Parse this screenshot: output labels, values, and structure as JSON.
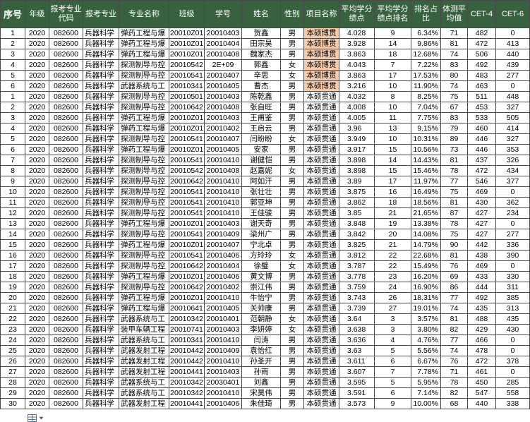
{
  "colors": {
    "header_bg": "#38613f",
    "header_text": "#ffffff",
    "highlight_fill": "#f8cbad",
    "grid_line": "#4a4a4a"
  },
  "table": {
    "headers": [
      "序号",
      "年级",
      "报考专业代码",
      "报考专业",
      "专业名称",
      "班级",
      "学号",
      "姓名",
      "性别",
      "项目名称",
      "平均学分绩点",
      "平均学分绩点排名",
      "排名占比",
      "体测平均值",
      "CET-4",
      "CET-6"
    ],
    "rows": [
      {
        "cells": [
          "1",
          "2020",
          "082600",
          "兵器科学",
          "弹药工程与爆",
          "20010Z01",
          "20010403",
          "贺鑫",
          "男",
          "本硕博贯",
          "4.028",
          "9",
          "6.34%",
          "71",
          "482",
          "0"
        ],
        "highlight": true
      },
      {
        "cells": [
          "2",
          "2020",
          "082600",
          "兵器科学",
          "弹药工程与爆",
          "20010Z01",
          "20010404",
          "田宗昊",
          "男",
          "本硕博贯",
          "3.928",
          "14",
          "9.86%",
          "81",
          "472",
          "413"
        ],
        "highlight": true
      },
      {
        "cells": [
          "3",
          "2020",
          "082600",
          "兵器科学",
          "弹药工程与爆",
          "20010Z01",
          "20010408",
          "魏家杰",
          "男",
          "本硕博贯",
          "3.863",
          "18",
          "12.68%",
          "74",
          "506",
          "440"
        ],
        "highlight": true
      },
      {
        "cells": [
          "4",
          "2020",
          "082600",
          "兵器科学",
          "探测制导与控",
          "20010542",
          "2E+09",
          "郭鑫",
          "女",
          "本硕博贯",
          "4.043",
          "7",
          "7.22%",
          "83",
          "492",
          "439"
        ],
        "highlight": true
      },
      {
        "cells": [
          "5",
          "2020",
          "082600",
          "兵器科学",
          "探测制导与控",
          "20010541",
          "20010407",
          "辛思",
          "女",
          "本硕博贯",
          "3.863",
          "17",
          "17.53%",
          "80",
          "483",
          "277"
        ],
        "highlight": true
      },
      {
        "cells": [
          "6",
          "2020",
          "082600",
          "兵器科学",
          "武器系统与工",
          "20010341",
          "20010405",
          "曹杰",
          "男",
          "本硕博贯",
          "3.216",
          "10",
          "11.90%",
          "74",
          "463",
          "0"
        ],
        "highlight": true
      },
      {
        "cells": [
          "1",
          "2020",
          "082600",
          "兵器科学",
          "探测制导与控",
          "20010501",
          "20010403",
          "陈乾鑫",
          "男",
          "本硕贯通",
          "4.032",
          "8",
          "8.25%",
          "75",
          "511",
          "448"
        ]
      },
      {
        "cells": [
          "2",
          "2020",
          "082600",
          "兵器科学",
          "探测制导与控",
          "20010642",
          "20010408",
          "张自旺",
          "男",
          "本硕贯通",
          "4.008",
          "10",
          "7.04%",
          "67",
          "453",
          "327"
        ]
      },
      {
        "cells": [
          "3",
          "2020",
          "082600",
          "兵器科学",
          "弹药工程与爆",
          "20010Z01",
          "20010403",
          "王甫鉴",
          "男",
          "本硕贯通",
          "4.005",
          "11",
          "7.75%",
          "83",
          "533",
          "505"
        ]
      },
      {
        "cells": [
          "4",
          "2020",
          "082600",
          "兵器科学",
          "弹药工程与爆",
          "20010Z01",
          "20010402",
          "王启云",
          "男",
          "本硕贯通",
          "3.96",
          "13",
          "9.15%",
          "79",
          "460",
          "414"
        ]
      },
      {
        "cells": [
          "5",
          "2020",
          "082600",
          "兵器科学",
          "探测制导与控",
          "20010541",
          "20010407",
          "闫盼盼",
          "女",
          "本硕贯通",
          "3.949",
          "10",
          "10.31%",
          "89",
          "446",
          "327"
        ]
      },
      {
        "cells": [
          "6",
          "2020",
          "082600",
          "兵器科学",
          "弹药工程与爆",
          "20010Z01",
          "20010405",
          "安家",
          "男",
          "本硕贯通",
          "3.917",
          "15",
          "10.56%",
          "73",
          "446",
          "353"
        ]
      },
      {
        "cells": [
          "7",
          "2020",
          "082600",
          "兵器科学",
          "探测制导与控",
          "20010541",
          "20010410",
          "谢健恺",
          "男",
          "本硕贯通",
          "3.898",
          "14",
          "14.43%",
          "81",
          "437",
          "326"
        ]
      },
      {
        "cells": [
          "8",
          "2020",
          "082600",
          "兵器科学",
          "探测制导与控",
          "20010542",
          "20010408",
          "赵嘉妮",
          "女",
          "本硕贯通",
          "3.898",
          "15",
          "15.46%",
          "78",
          "472",
          "434"
        ]
      },
      {
        "cells": [
          "9",
          "2020",
          "082600",
          "兵器科学",
          "探测制导与控",
          "20010642",
          "20010410",
          "阿如汗",
          "男",
          "本硕贯通",
          "3.89",
          "17",
          "11.97%",
          "77",
          "546",
          "377"
        ]
      },
      {
        "cells": [
          "10",
          "2020",
          "082600",
          "兵器科学",
          "探测制导与控",
          "20010541",
          "20010410",
          "张壮壮",
          "男",
          "本硕贯通",
          "3.875",
          "16",
          "16.49%",
          "75",
          "469",
          "0"
        ]
      },
      {
        "cells": [
          "11",
          "2020",
          "082600",
          "兵器科学",
          "探测制导与控",
          "20010541",
          "20010410",
          "郭亚坤",
          "男",
          "本硕贯通",
          "3.862",
          "18",
          "18.56%",
          "81",
          "430",
          "362"
        ]
      },
      {
        "cells": [
          "12",
          "2020",
          "082600",
          "兵器科学",
          "探测制导与控",
          "20010541",
          "20010410",
          "王佳骏",
          "男",
          "本硕贯通",
          "3.85",
          "21",
          "21.65%",
          "87",
          "427",
          "234"
        ]
      },
      {
        "cells": [
          "13",
          "2020",
          "082600",
          "兵器科学",
          "弹药工程与爆",
          "20010Z01",
          "20010403",
          "谢天奇",
          "男",
          "本硕贯通",
          "3.848",
          "19",
          "13.38%",
          "78",
          "427",
          "0"
        ]
      },
      {
        "cells": [
          "14",
          "2020",
          "082600",
          "兵器科学",
          "探测制导与控",
          "20010541",
          "20010409",
          "梁州广",
          "男",
          "本硕贯通",
          "3.842",
          "20",
          "14.08%",
          "75",
          "427",
          "277"
        ]
      },
      {
        "cells": [
          "15",
          "2020",
          "082600",
          "兵器科学",
          "弹药工程与爆",
          "20010Z01",
          "20010407",
          "宁北卓",
          "男",
          "本硕贯通",
          "3.825",
          "21",
          "14.79%",
          "90",
          "442",
          "336"
        ]
      },
      {
        "cells": [
          "16",
          "2020",
          "082600",
          "兵器科学",
          "探测制导与控",
          "20010541",
          "20010406",
          "方玲玲",
          "女",
          "本硕贯通",
          "3.812",
          "22",
          "22.68%",
          "81",
          "438",
          "390"
        ]
      },
      {
        "cells": [
          "17",
          "2020",
          "082600",
          "兵器科学",
          "探测制导与控",
          "20010642",
          "20010404",
          "徐璧",
          "女",
          "本硕贯通",
          "3.787",
          "22",
          "15.49%",
          "76",
          "469",
          "0"
        ]
      },
      {
        "cells": [
          "18",
          "2020",
          "082600",
          "兵器科学",
          "弹药工程与爆",
          "20010Z01",
          "20010406",
          "黄文博",
          "男",
          "本硕贯通",
          "3.778",
          "23",
          "16.20%",
          "69",
          "433",
          "330"
        ]
      },
      {
        "cells": [
          "19",
          "2020",
          "082600",
          "兵器科学",
          "探测制导与控",
          "20010642",
          "20010402",
          "崇江伟",
          "男",
          "本硕贯通",
          "3.759",
          "24",
          "16.90%",
          "86",
          "444",
          "311"
        ]
      },
      {
        "cells": [
          "20",
          "2020",
          "082600",
          "兵器科学",
          "弹药工程与爆",
          "20010Z01",
          "20010410",
          "牛怡宁",
          "男",
          "本硕贯通",
          "3.743",
          "26",
          "18.31%",
          "77",
          "492",
          "385"
        ]
      },
      {
        "cells": [
          "21",
          "2020",
          "082600",
          "兵器科学",
          "弹药工程与爆",
          "20010641",
          "20010405",
          "关帅康",
          "男",
          "本硕贯通",
          "3.739",
          "27",
          "19.01%",
          "74",
          "435",
          "313"
        ]
      },
      {
        "cells": [
          "22",
          "2020",
          "082600",
          "兵器科学",
          "武器系统与工",
          "20010342",
          "20010401",
          "范朝静",
          "女",
          "本硕贯通",
          "3.64",
          "3",
          "3.57%",
          "81",
          "488",
          "435"
        ]
      },
      {
        "cells": [
          "23",
          "2020",
          "082600",
          "兵器科学",
          "装甲车辆工程",
          "20010741",
          "20010403",
          "李妍婷",
          "女",
          "本硕贯通",
          "3.638",
          "3",
          "3.80%",
          "82",
          "429",
          "430"
        ]
      },
      {
        "cells": [
          "24",
          "2020",
          "082600",
          "兵器科学",
          "武器系统与工",
          "20010341",
          "20010410",
          "闫涛",
          "男",
          "本硕贯通",
          "3.636",
          "4",
          "4.76%",
          "77",
          "466",
          "0"
        ]
      },
      {
        "cells": [
          "25",
          "2020",
          "082600",
          "兵器科学",
          "武器发射工程",
          "20010442",
          "20010409",
          "袁怡红",
          "男",
          "本硕贯通",
          "3.63",
          "5",
          "5.56%",
          "74",
          "478",
          "0"
        ]
      },
      {
        "cells": [
          "26",
          "2020",
          "082600",
          "兵器科学",
          "武器发射工程",
          "20010442",
          "20010410",
          "孙圣开",
          "男",
          "本硕贯通",
          "3.611",
          "6",
          "6.67%",
          "76",
          "472",
          "378"
        ]
      },
      {
        "cells": [
          "27",
          "2020",
          "082600",
          "兵器科学",
          "武器发射工程",
          "20010441",
          "20010403",
          "孙雨",
          "男",
          "本硕贯通",
          "3.607",
          "7",
          "7.78%",
          "71",
          "461",
          "0"
        ]
      },
      {
        "cells": [
          "28",
          "2020",
          "082600",
          "兵器科学",
          "武器系统与工",
          "20010342",
          "20030401",
          "刘鑫",
          "男",
          "本硕贯通",
          "3.595",
          "5",
          "5.95%",
          "78",
          "450",
          "285"
        ]
      },
      {
        "cells": [
          "29",
          "2020",
          "082600",
          "兵器科学",
          "武器系统与工",
          "20010342",
          "20010410",
          "宋昊伟",
          "男",
          "本硕贯通",
          "3.591",
          "6",
          "7.14%",
          "82",
          "547",
          "558"
        ]
      },
      {
        "cells": [
          "30",
          "2020",
          "082600",
          "兵器科学",
          "武器发射工程",
          "20010441",
          "20010406",
          "朱佳琦",
          "男",
          "本硕贯通",
          "3.573",
          "9",
          "10.00%",
          "68",
          "440",
          "338"
        ]
      }
    ]
  },
  "footer": {
    "paste_options_icon": "table-grid-icon",
    "dropdown_icon": "chevron-down-icon"
  }
}
